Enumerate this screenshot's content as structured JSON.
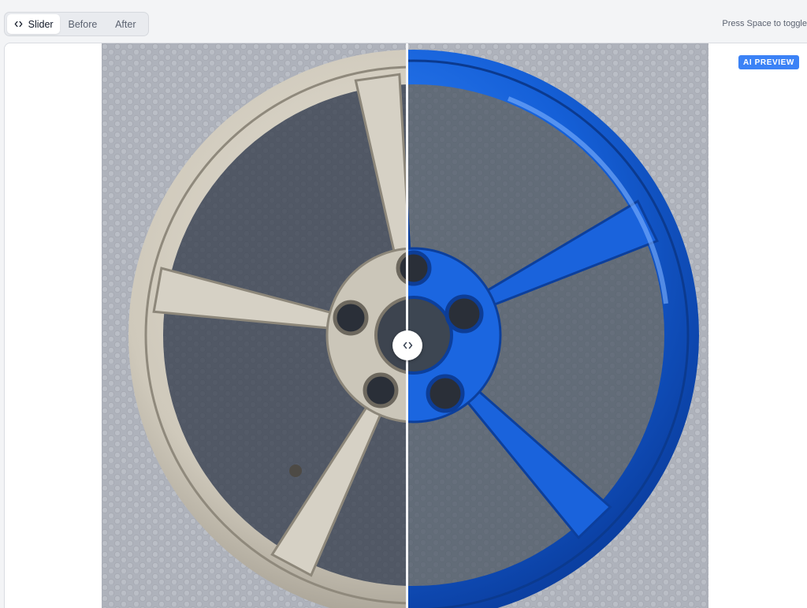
{
  "toolbar": {
    "modes": [
      {
        "label": "Slider",
        "icon": "chevron-left-right-icon",
        "selected": true
      },
      {
        "label": "Before",
        "selected": false
      },
      {
        "label": "After",
        "selected": false
      }
    ],
    "hint": "Press Space to toggle"
  },
  "compare": {
    "badge": "AI PREVIEW",
    "slider_position_fraction": 0.5,
    "before_image": "wheel-original-silver",
    "after_image": "wheel-painted-blue",
    "handle_icon": "chevron-left-right-icon"
  },
  "colors": {
    "accent": "#3b82f6",
    "after_paint": "#1a5fd6",
    "before_metal": "#c9c4b7"
  }
}
